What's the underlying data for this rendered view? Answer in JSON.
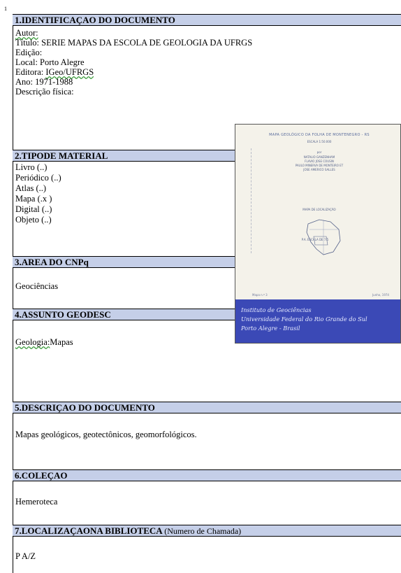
{
  "corner_mark": "1",
  "sections": {
    "s1": {
      "title": "1.IDENTIFICAÇAO DO DOCUMENTO"
    },
    "s2": {
      "title": "2.TIPODE MATERIAL"
    },
    "s3": {
      "title": "3.AREA DO CNPq"
    },
    "s4": {
      "title": "4.ASSUNTO GEODESC"
    },
    "s5": {
      "title": "5.DESCRIÇAO DO DOCUMENTO"
    },
    "s6": {
      "title": "6.COLEÇAO"
    },
    "s7": {
      "title": "7.LOCALIZAÇAONA BIBLIOTECA",
      "subtitle": "(Numero de Chamada)"
    }
  },
  "identificacao": {
    "autor_label": "Autor:",
    "titulo": "Título: SERIE MAPAS DA ESCOLA DE GEOLOGIA DA UFRGS",
    "edicao": "Edição:",
    "local": "Local: Porto Alegre",
    "editora_label": "Editora:",
    "editora_value": "IGeo/UFRGS",
    "ano": "Ano: 1971-1988",
    "descricao_fisica": "Descrição física:"
  },
  "material": {
    "livro": "Livro (..)",
    "periodico": "Periódico (..)",
    "atlas": "Atlas (..)",
    "mapa": "Mapa (.x )",
    "digital": "Digital (..)",
    "objeto": "Objeto (..)"
  },
  "area_cnpq": "Geociências",
  "assunto": {
    "main": "Geologia:",
    "rest": "Mapas"
  },
  "descricao": "Mapas geológicos, geotectônicos, geomorfológicos.",
  "colecao": "Hemeroteca",
  "localizacao": "P A/Z",
  "cover": {
    "title": "MAPA GEOLÓGICO DA FOLHA DE MONTENEGRO - RS",
    "scale": "ESCALA 1:50.000",
    "line_por": "por",
    "authors": [
      "NATALIO GANZENHAM",
      "FLAVIO JOSE COUSIN",
      "PAULO MINERVA DE MONTEIRO ET",
      "JOSE AMERICO SALLES"
    ],
    "map_label": "MAPA DE LOCALIZAÇÃO",
    "box_text": "P.A. ESCALA DE 7.5",
    "foot_left": "Mapa n.º 3",
    "foot_right": "Junho, 1974",
    "inst1": "Instituto de Geociências",
    "inst2": "Universidade Federal do Rio Grande do Sul",
    "inst3": "Porto Alegre - Brasil"
  }
}
